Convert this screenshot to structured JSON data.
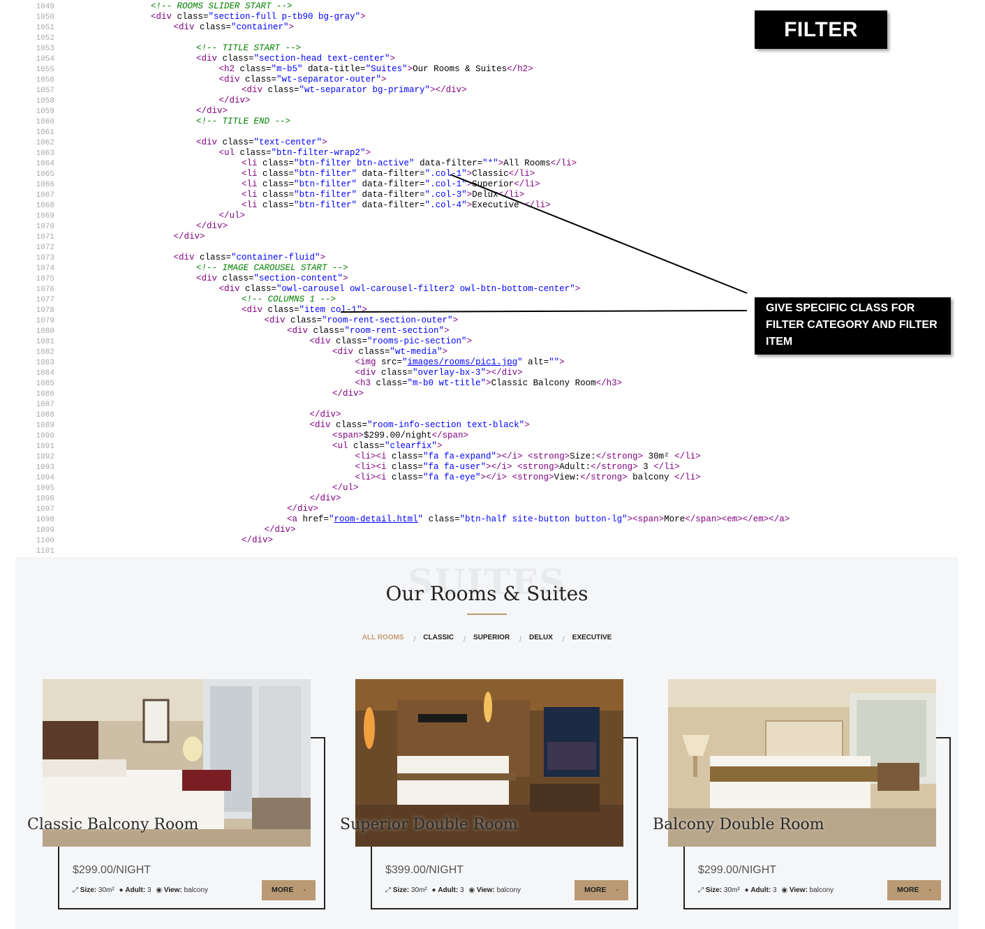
{
  "code": {
    "lines": [
      {
        "n": "1049",
        "indent": 4,
        "html": "<span class='cmt'>&lt;!-- ROOMS SLIDER START --&gt;</span>"
      },
      {
        "n": "1050",
        "indent": 4,
        "html": "<span class='tag'>&lt;div</span> class=<span class='val'>\"section-full p-tb90 bg-gray\"</span><span class='tag'>&gt;</span>"
      },
      {
        "n": "1051",
        "indent": 5,
        "html": "<span class='tag'>&lt;div</span> class=<span class='val'>\"container\"</span><span class='tag'>&gt;</span>"
      },
      {
        "n": "1052",
        "indent": 0,
        "html": ""
      },
      {
        "n": "1053",
        "indent": 6,
        "html": "<span class='cmt'>&lt;!-- TITLE START --&gt;</span>"
      },
      {
        "n": "1054",
        "indent": 6,
        "html": "<span class='tag'>&lt;div</span> class=<span class='val'>\"section-head text-center\"</span><span class='tag'>&gt;</span>"
      },
      {
        "n": "1055",
        "indent": 7,
        "html": "<span class='tag'>&lt;h2</span> class=<span class='val'>\"m-b5\"</span> data-title=<span class='val'>\"Suites\"</span><span class='tag'>&gt;</span>Our Rooms &amp; Suites<span class='tag'>&lt;/h2&gt;</span>"
      },
      {
        "n": "1056",
        "indent": 7,
        "html": "<span class='tag'>&lt;div</span> class=<span class='val'>\"wt-separator-outer\"</span><span class='tag'>&gt;</span>"
      },
      {
        "n": "1057",
        "indent": 8,
        "html": "<span class='tag'>&lt;div</span> class=<span class='val'>\"wt-separator bg-primary\"</span><span class='tag'>&gt;&lt;/div&gt;</span>"
      },
      {
        "n": "1058",
        "indent": 7,
        "html": "<span class='tag'>&lt;/div&gt;</span>"
      },
      {
        "n": "1059",
        "indent": 6,
        "html": "<span class='tag'>&lt;/div&gt;</span>"
      },
      {
        "n": "1060",
        "indent": 6,
        "html": "<span class='cmt'>&lt;!-- TITLE END --&gt;</span>"
      },
      {
        "n": "1061",
        "indent": 0,
        "html": ""
      },
      {
        "n": "1062",
        "indent": 6,
        "html": "<span class='tag'>&lt;div</span> class=<span class='val'>\"text-center\"</span><span class='tag'>&gt;</span>"
      },
      {
        "n": "1063",
        "indent": 7,
        "html": "<span class='tag'>&lt;ul</span> class=<span class='val'>\"btn-filter-wrap2\"</span><span class='tag'>&gt;</span>"
      },
      {
        "n": "1064",
        "indent": 8,
        "html": "<span class='tag'>&lt;li</span> class=<span class='val'>\"btn-filter btn-active\"</span> data-filter=<span class='val'>\"*\"</span><span class='tag'>&gt;</span>All Rooms<span class='tag'>&lt;/li&gt;</span>"
      },
      {
        "n": "1065",
        "indent": 8,
        "html": "<span class='tag'>&lt;li</span> class=<span class='val'>\"btn-filter\"</span> data-filter=<span class='val'>\".col-1\"</span><span class='tag'>&gt;</span>Classic<span class='tag'>&lt;/li&gt;</span>"
      },
      {
        "n": "1066",
        "indent": 8,
        "html": "<span class='tag'>&lt;li</span> class=<span class='val'>\"btn-filter\"</span> data-filter=<span class='val'>\".col-1\"</span><span class='tag'>&gt;</span>Superior<span class='tag'>&lt;/li&gt;</span>"
      },
      {
        "n": "1067",
        "indent": 8,
        "html": "<span class='tag'>&lt;li</span> class=<span class='val'>\"btn-filter\"</span> data-filter=<span class='val'>\".col-3\"</span><span class='tag'>&gt;</span>Delux<span class='tag'>&lt;/li&gt;</span>"
      },
      {
        "n": "1068",
        "indent": 8,
        "html": "<span class='tag'>&lt;li</span> class=<span class='val'>\"btn-filter\"</span> data-filter=<span class='val'>\".col-4\"</span><span class='tag'>&gt;</span>Executive <span class='tag'>&lt;/li&gt;</span>"
      },
      {
        "n": "1069",
        "indent": 7,
        "html": "<span class='tag'>&lt;/ul&gt;</span>"
      },
      {
        "n": "1070",
        "indent": 6,
        "html": "<span class='tag'>&lt;/div&gt;</span>"
      },
      {
        "n": "1071",
        "indent": 5,
        "html": "<span class='tag'>&lt;/div&gt;</span>"
      },
      {
        "n": "1072",
        "indent": 0,
        "html": ""
      },
      {
        "n": "1073",
        "indent": 5,
        "html": "<span class='tag'>&lt;div</span> class=<span class='val'>\"container-fluid\"</span><span class='tag'>&gt;</span>"
      },
      {
        "n": "1074",
        "indent": 6,
        "html": "<span class='cmt'>&lt;!-- IMAGE CAROUSEL START --&gt;</span>"
      },
      {
        "n": "1075",
        "indent": 6,
        "html": "<span class='tag'>&lt;div</span> class=<span class='val'>\"section-content\"</span><span class='tag'>&gt;</span>"
      },
      {
        "n": "1076",
        "indent": 7,
        "html": "<span class='tag'>&lt;div</span> class=<span class='val'>\"owl-carousel owl-carousel-filter2 owl-btn-bottom-center\"</span><span class='tag'>&gt;</span>"
      },
      {
        "n": "1077",
        "indent": 8,
        "html": "<span class='cmt'>&lt;!-- COLUMNS 1 --&gt;</span>"
      },
      {
        "n": "1078",
        "indent": 8,
        "html": "<span class='tag'>&lt;div</span> class=<span class='val'>\"item col-1\"</span><span class='tag'>&gt;</span>"
      },
      {
        "n": "1079",
        "indent": 9,
        "html": "<span class='tag'>&lt;div</span> class=<span class='val'>\"room-rent-section-outer\"</span><span class='tag'>&gt;</span>"
      },
      {
        "n": "1080",
        "indent": 10,
        "html": "<span class='tag'>&lt;div</span> class=<span class='val'>\"room-rent-section\"</span><span class='tag'>&gt;</span>"
      },
      {
        "n": "1081",
        "indent": 11,
        "html": "<span class='tag'>&lt;div</span> class=<span class='val'>\"rooms-pic-section\"</span><span class='tag'>&gt;</span>"
      },
      {
        "n": "1082",
        "indent": 12,
        "html": "<span class='tag'>&lt;div</span> class=<span class='val'>\"wt-media\"</span><span class='tag'>&gt;</span>"
      },
      {
        "n": "1083",
        "indent": 13,
        "html": "<span class='tag'>&lt;img</span> src=<span class='val'>\"<span class='lnk'>images/rooms/pic1.jpg</span>\"</span> alt=<span class='val'>\"\"</span><span class='tag'>&gt;</span>"
      },
      {
        "n": "1084",
        "indent": 13,
        "html": "<span class='tag'>&lt;div</span> class=<span class='val'>\"overlay-bx-3\"</span><span class='tag'>&gt;&lt;/div&gt;</span>"
      },
      {
        "n": "1085",
        "indent": 13,
        "html": "<span class='tag'>&lt;h3</span> class=<span class='val'>\"m-b0 wt-title\"</span><span class='tag'>&gt;</span>Classic Balcony Room<span class='tag'>&lt;/h3&gt;</span>"
      },
      {
        "n": "1086",
        "indent": 12,
        "html": "<span class='tag'>&lt;/div&gt;</span>"
      },
      {
        "n": "1087",
        "indent": 0,
        "html": ""
      },
      {
        "n": "1088",
        "indent": 11,
        "html": "<span class='tag'>&lt;/div&gt;</span>"
      },
      {
        "n": "1089",
        "indent": 11,
        "html": "<span class='tag'>&lt;div</span> class=<span class='val'>\"room-info-section text-black\"</span><span class='tag'>&gt;</span>"
      },
      {
        "n": "1090",
        "indent": 12,
        "html": "<span class='tag'>&lt;span&gt;</span>$299.00/night<span class='tag'>&lt;/span&gt;</span>"
      },
      {
        "n": "1091",
        "indent": 12,
        "html": "<span class='tag'>&lt;ul</span> class=<span class='val'>\"clearfix\"</span><span class='tag'>&gt;</span>"
      },
      {
        "n": "1092",
        "indent": 13,
        "html": "<span class='tag'>&lt;li&gt;&lt;i</span> class=<span class='val'>\"fa fa-expand\"</span><span class='tag'>&gt;&lt;/i&gt;</span> <span class='tag'>&lt;strong&gt;</span>Size:<span class='tag'>&lt;/strong&gt;</span> 30m² <span class='tag'>&lt;/li&gt;</span>"
      },
      {
        "n": "1093",
        "indent": 13,
        "html": "<span class='tag'>&lt;li&gt;&lt;i</span> class=<span class='val'>\"fa fa-user\"</span><span class='tag'>&gt;&lt;/i&gt;</span> <span class='tag'>&lt;strong&gt;</span>Adult:<span class='tag'>&lt;/strong&gt;</span> 3 <span class='tag'>&lt;/li&gt;</span>"
      },
      {
        "n": "1094",
        "indent": 13,
        "html": "<span class='tag'>&lt;li&gt;&lt;i</span> class=<span class='val'>\"fa fa-eye\"</span><span class='tag'>&gt;&lt;/i&gt;</span> <span class='tag'>&lt;strong&gt;</span>View:<span class='tag'>&lt;/strong&gt;</span> balcony <span class='tag'>&lt;/li&gt;</span>"
      },
      {
        "n": "1095",
        "indent": 12,
        "html": "<span class='tag'>&lt;/ul&gt;</span>"
      },
      {
        "n": "1096",
        "indent": 11,
        "html": "<span class='tag'>&lt;/div&gt;</span>"
      },
      {
        "n": "1097",
        "indent": 10,
        "html": "<span class='tag'>&lt;/div&gt;</span>"
      },
      {
        "n": "1098",
        "indent": 10,
        "html": "<span class='tag'>&lt;a</span> href=<span class='val'>\"<span class='lnk'>room-detail.html</span>\"</span> class=<span class='val'>\"btn-half site-button button-lg\"</span><span class='tag'>&gt;&lt;span&gt;</span>More<span class='tag'>&lt;/span&gt;&lt;em&gt;&lt;/em&gt;&lt;/a&gt;</span>"
      },
      {
        "n": "1099",
        "indent": 9,
        "html": "<span class='tag'>&lt;/div&gt;</span>"
      },
      {
        "n": "1100",
        "indent": 8,
        "html": "<span class='tag'>&lt;/div&gt;</span>"
      },
      {
        "n": "1101",
        "indent": 0,
        "html": ""
      }
    ]
  },
  "callouts": {
    "filter_label": "FILTER",
    "note": "GIVE SPECIFIC CLASS FOR FILTER CATEGORY AND FILTER ITEM"
  },
  "section": {
    "bg_word": "SUITES",
    "title": "Our Rooms & Suites",
    "filters": [
      "ALL ROOMS",
      "CLASSIC",
      "SUPERIOR",
      "DELUX",
      "EXECUTIVE"
    ],
    "active_filter": "ALL ROOMS",
    "filter_separator": "/"
  },
  "rooms": [
    {
      "title": "Classic Balcony Room",
      "price": "$299.00/NIGHT",
      "size_label": "Size:",
      "size": "30m²",
      "adult_label": "Adult:",
      "adult": "3",
      "view_label": "View:",
      "view": "balcony",
      "button": "MORE",
      "button_dash": "-"
    },
    {
      "title": "Superior Double Room",
      "price": "$399.00/NIGHT",
      "size_label": "Size:",
      "size": "30m²",
      "adult_label": "Adult:",
      "adult": "3",
      "view_label": "View:",
      "view": "balcony",
      "button": "MORE",
      "button_dash": "-"
    },
    {
      "title": "Balcony Double Room",
      "price": "$299.00/NIGHT",
      "size_label": "Size:",
      "size": "30m²",
      "adult_label": "Adult:",
      "adult": "3",
      "view_label": "View:",
      "view": "balcony",
      "button": "MORE",
      "button_dash": "-"
    }
  ],
  "colors": {
    "accent": "#b99a74",
    "active_filter": "#c29f76",
    "section_bg": "#f5f6f8",
    "code_tag": "#800080",
    "code_value": "#0000ff",
    "code_comment": "#008000"
  }
}
